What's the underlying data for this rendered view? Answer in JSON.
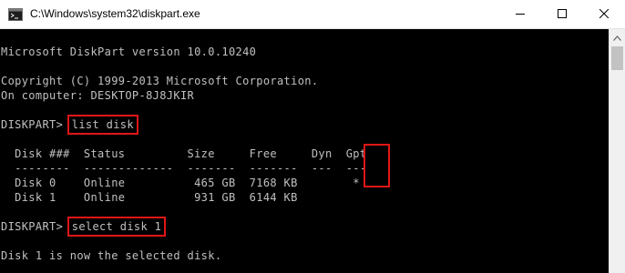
{
  "window": {
    "title": "C:\\Windows\\system32\\diskpart.exe",
    "icon": "console-icon",
    "controls": {
      "minimize": "minimize-icon",
      "maximize": "maximize-icon",
      "close": "close-icon"
    }
  },
  "console": {
    "version_line": "Microsoft DiskPart version 10.0.10240",
    "copyright_line": "Copyright (C) 1999-2013 Microsoft Corporation.",
    "computer_line": "On computer: DESKTOP-8J8JKIR",
    "prompt": "DISKPART> ",
    "command1": "list disk",
    "table": {
      "header_left": "  Disk ###  Status         Size     Free     Dyn  ",
      "header_gpt": "Gpt",
      "separator_left": "  --------  -------------  -------  -------  ---  ",
      "separator_gpt": "---",
      "rows": [
        {
          "left": "  Disk 0    Online          465 GB  7168 KB       ",
          "gpt": " *"
        },
        {
          "left": "  Disk 1    Online          931 GB  6144 KB       ",
          "gpt": ""
        }
      ]
    },
    "command2": "select disk 1",
    "result_line": "Disk 1 is now the selected disk."
  },
  "colors": {
    "console_background": "#000000",
    "console_text": "#c0c0c0",
    "highlight_border": "#e01616",
    "titlebar_background": "#ffffff"
  }
}
